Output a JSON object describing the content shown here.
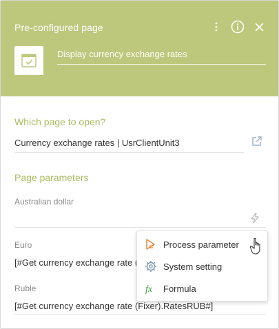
{
  "header": {
    "title": "Pre-configured page",
    "caption": "Display currency exchange rates",
    "icons": {
      "more": "more-vertical-icon",
      "info": "info-icon",
      "close": "close-icon",
      "page": "page-card-icon"
    },
    "color": "#bdc87c"
  },
  "which_page": {
    "title": "Which page to open?",
    "value": "Currency exchange rates | UsrClientUnit3",
    "open_icon": "open-external-icon"
  },
  "parameters": {
    "title": "Page parameters",
    "items": [
      {
        "label": "Australian dollar",
        "value": ""
      },
      {
        "label": "Euro",
        "value": "[#Get currency exchange rate (Fixer).RatesEUR#]"
      },
      {
        "label": "Ruble",
        "value": "[#Get currency exchange rate (Fixer).RatesRUB#]"
      }
    ],
    "bolt_icon": "lightning-icon"
  },
  "menu": {
    "items": [
      {
        "label": "Process parameter",
        "icon": "process-parameter-icon"
      },
      {
        "label": "System setting",
        "icon": "gear-icon"
      },
      {
        "label": "Formula",
        "icon": "fx-icon"
      }
    ]
  },
  "colors": {
    "accent": "#aab85e",
    "process_icon": "#f0873a",
    "formula_icon": "#3b9a3e"
  }
}
